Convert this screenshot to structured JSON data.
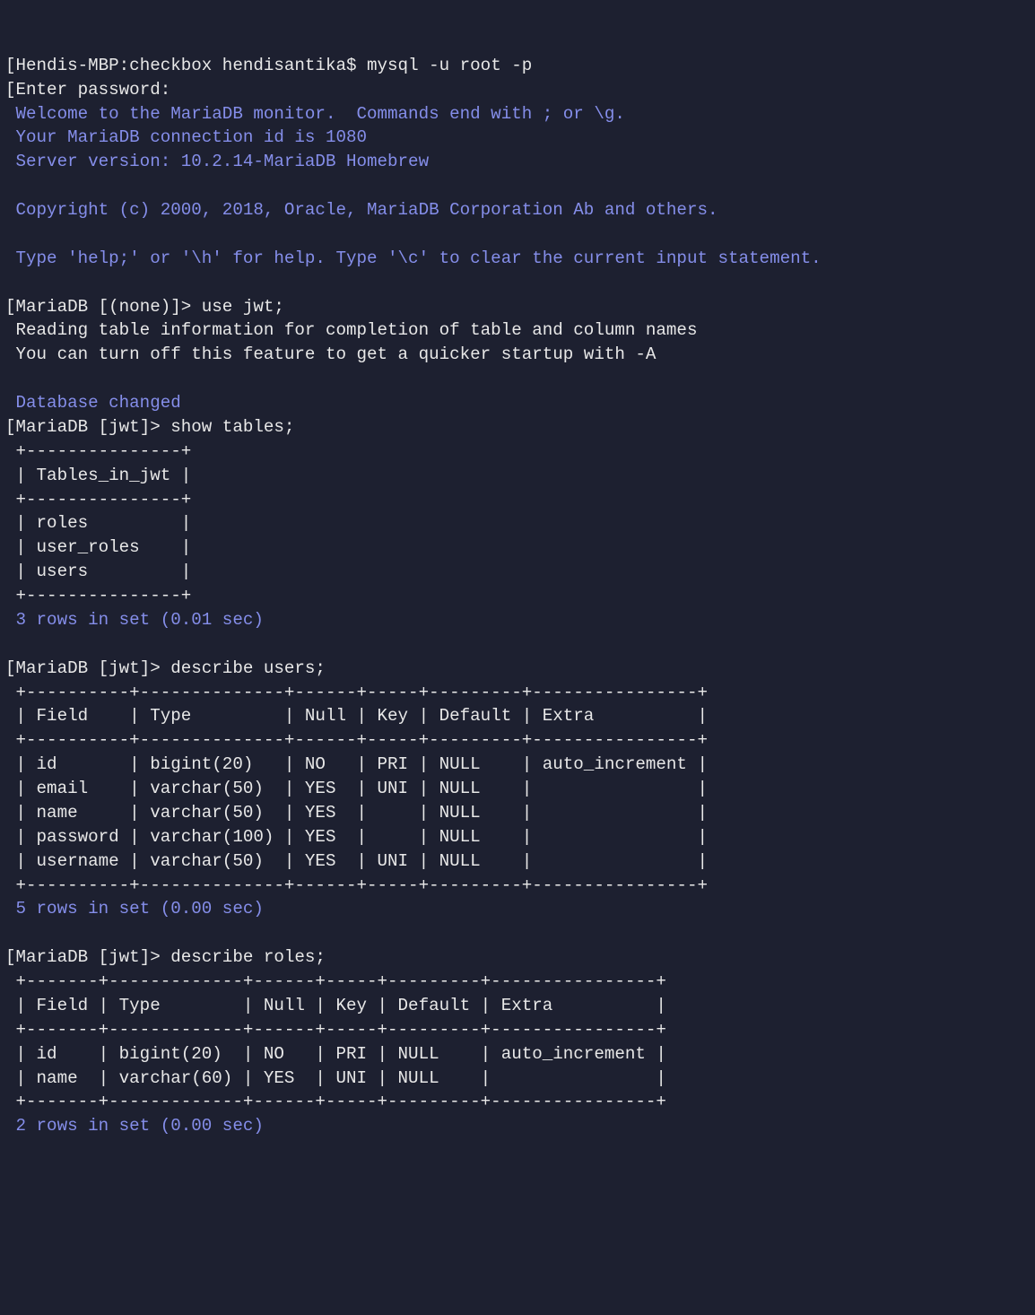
{
  "shell_prompt": "Hendis-MBP:checkbox hendisantika$ ",
  "shell_command": "mysql -u root -p",
  "password_prompt": "Enter password:",
  "banner": {
    "welcome": " Welcome to the MariaDB monitor.  Commands end with ; or \\g.",
    "conn_id": " Your MariaDB connection id is 1080",
    "server": " Server version: 10.2.14-MariaDB Homebrew",
    "copyright": " Copyright (c) 2000, 2018, Oracle, MariaDB Corporation Ab and others.",
    "help": " Type 'help;' or '\\h' for help. Type '\\c' to clear the current input statement."
  },
  "step1": {
    "prompt": "MariaDB [(none)]> ",
    "command": "use jwt;",
    "msg1": " Reading table information for completion of table and column names",
    "msg2": " You can turn off this feature to get a quicker startup with -A",
    "changed": " Database changed"
  },
  "step2": {
    "prompt": "MariaDB [jwt]> ",
    "command": "show tables;",
    "header": "Tables_in_jwt",
    "rows": [
      "roles",
      "user_roles",
      "users"
    ],
    "footer": " 3 rows in set (0.01 sec)"
  },
  "step3": {
    "prompt": "MariaDB [jwt]> ",
    "command": "describe users;",
    "columns": [
      "Field",
      "Type",
      "Null",
      "Key",
      "Default",
      "Extra"
    ],
    "widths": [
      8,
      12,
      4,
      3,
      7,
      14
    ],
    "rows": [
      [
        "id",
        "bigint(20)",
        "NO",
        "PRI",
        "NULL",
        "auto_increment"
      ],
      [
        "email",
        "varchar(50)",
        "YES",
        "UNI",
        "NULL",
        ""
      ],
      [
        "name",
        "varchar(50)",
        "YES",
        "",
        "NULL",
        ""
      ],
      [
        "password",
        "varchar(100)",
        "YES",
        "",
        "NULL",
        ""
      ],
      [
        "username",
        "varchar(50)",
        "YES",
        "UNI",
        "NULL",
        ""
      ]
    ],
    "footer": " 5 rows in set (0.00 sec)"
  },
  "step4": {
    "prompt": "MariaDB [jwt]> ",
    "command": "describe roles;",
    "columns": [
      "Field",
      "Type",
      "Null",
      "Key",
      "Default",
      "Extra"
    ],
    "widths": [
      5,
      11,
      4,
      3,
      7,
      14
    ],
    "rows": [
      [
        "id",
        "bigint(20)",
        "NO",
        "PRI",
        "NULL",
        "auto_increment"
      ],
      [
        "name",
        "varchar(60)",
        "YES",
        "UNI",
        "NULL",
        ""
      ]
    ],
    "footer": " 2 rows in set (0.00 sec)"
  }
}
